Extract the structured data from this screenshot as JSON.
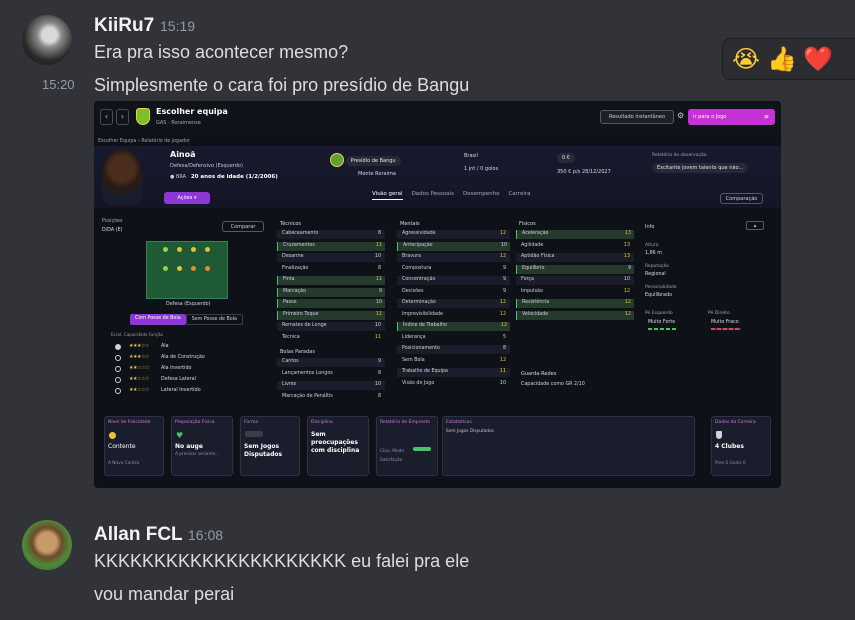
{
  "messages": [
    {
      "username": "KiiRu7",
      "time": "15:19",
      "lines": [
        "Era pra isso acontecer mesmo?",
        "Simplesmente o cara foi pro presídio de Bangu"
      ],
      "line_time": "15:20"
    },
    {
      "username": "Allan FCL",
      "time": "16:08",
      "lines": [
        "KKKKKKKKKKKKKKKKKKKKK eu falei pra ele",
        "vou mandar perai"
      ]
    }
  ],
  "reactions": [
    "😭",
    "👍",
    "❤️"
  ],
  "game": {
    "header_title": "Escolher equipa",
    "header_sub": "GAS  ·  Roraimense",
    "result_button": "Resultado instantâneo",
    "go_button": "Ir para o Jogo",
    "breadcrumb": "Escolher Equipa  ›  Relatório de jogador",
    "player_name": "Ainoã",
    "player_position": "Defesa/Defensivo (Esquerdo)",
    "player_nation": "BRA",
    "player_age": "20 anos de idade (1/2/2006)",
    "actions_button": "Ações",
    "club_name": "Presídio de Bangu",
    "club_league": "Monte Roraima",
    "country": "Brasil",
    "stats": "1 jnt / 0 golos",
    "value": "0 €",
    "wage": "350 € p/s  28/12/2027",
    "scout_label": "Relatório de observação",
    "scout_text": "Excitante jovem talento que não...",
    "tabs": [
      "Visão geral",
      "Dados Pessoais",
      "Desempenho",
      "Carreira"
    ],
    "comparison_button": "Comparação",
    "positions_label": "Posições",
    "positions_value": "D/DA (E)",
    "compare_button": "Comparar",
    "pitch_caption": "Defesa (Esquerdo)",
    "ball_tabs": [
      "Com Posse de Bola",
      "Sem Posse de Bola"
    ],
    "role_header": "Escol.    Capacidade     Função",
    "roles": [
      {
        "stars": "★★★☆☆",
        "name": "Ala"
      },
      {
        "stars": "★★★☆☆",
        "name": "Ala de Construção"
      },
      {
        "stars": "★★☆☆☆",
        "name": "Ala Invertido"
      },
      {
        "stars": "★★☆☆☆",
        "name": "Defesa Lateral"
      },
      {
        "stars": "★★☆☆☆",
        "name": "Lateral Invertido"
      }
    ],
    "attributes": {
      "tecnicos_title": "Técnicos",
      "tecnicos": [
        [
          "Cabeceamento",
          "8"
        ],
        [
          "Cruzamentos",
          "11"
        ],
        [
          "Desarme",
          "10"
        ],
        [
          "Finalização",
          "8"
        ],
        [
          "Finta",
          "11"
        ],
        [
          "Marcação",
          "9"
        ],
        [
          "Passe",
          "10"
        ],
        [
          "Primeiro Toque",
          "11"
        ],
        [
          "Remates de Longe",
          "10"
        ],
        [
          "Técnica",
          "11"
        ]
      ],
      "bolas_title": "Bolas Paradas",
      "bolas": [
        [
          "Cantos",
          "9"
        ],
        [
          "Lançamentos Longos",
          "8"
        ],
        [
          "Livres",
          "10"
        ],
        [
          "Marcação de Penáltis",
          "8"
        ]
      ],
      "mentais_title": "Mentais",
      "mentais": [
        [
          "Agressividade",
          "12"
        ],
        [
          "Antecipação",
          "10"
        ],
        [
          "Bravura",
          "12"
        ],
        [
          "Compostura",
          "9"
        ],
        [
          "Concentração",
          "9"
        ],
        [
          "Decisões",
          "9"
        ],
        [
          "Determinação",
          "12"
        ],
        [
          "Imprevisibilidade",
          "12"
        ],
        [
          "Índice de Trabalho",
          "12"
        ],
        [
          "Liderança",
          "5"
        ],
        [
          "Posicionamento",
          "8"
        ],
        [
          "Sem Bola",
          "12"
        ],
        [
          "Trabalho de Equipa",
          "11"
        ],
        [
          "Visão de Jogo",
          "10"
        ]
      ],
      "fisicos_title": "Físicos",
      "fisicos": [
        [
          "Aceleração",
          "13"
        ],
        [
          "Agilidade",
          "13"
        ],
        [
          "Aptidão Física",
          "13"
        ],
        [
          "Equilíbrio",
          "9"
        ],
        [
          "Força",
          "10"
        ],
        [
          "Impulsão",
          "12"
        ],
        [
          "Resistência",
          "12"
        ],
        [
          "Velocidade",
          "12"
        ]
      ],
      "gk_title": "Guarda-Redes",
      "gk_value": "Capacidade como GR  2/10"
    },
    "info": {
      "title": "Info",
      "height_label": "Altura",
      "height": "1,86 m",
      "reputation_label": "Reputação",
      "reputation": "Regional",
      "personality_label": "Personalidade",
      "personality": "Equilibrado",
      "left_foot_label": "Pé Esquerdo",
      "left_foot": "Muito Forte",
      "right_foot_label": "Pé Direito",
      "right_foot": "Muito Fraco"
    },
    "cards": [
      {
        "title": "Nível de Felicidade",
        "value": "Contente",
        "sub": "A Novo  Contra"
      },
      {
        "title": "Preparação Física",
        "value": "No auge",
        "sub": "A precisar seriame..."
      },
      {
        "title": "Forma",
        "value": "Sem Jogos Disputados",
        "sub": ""
      },
      {
        "title": "Disciplina",
        "value": "Sem preocupações com disciplina",
        "sub": ""
      },
      {
        "title": "Relatório de Empresto",
        "value": "",
        "sub": "Clou. Mode  Satisfação"
      },
      {
        "title": "Estatísticas",
        "value": "",
        "sub": "Sem Jogos Disputados"
      },
      {
        "title": "Dados da Carreira",
        "value": "4 Clubes",
        "sub": "Pres 0   Golos 0"
      }
    ]
  },
  "colors": {
    "background": "#313338",
    "accent": "#c532d6",
    "text": "#dbdee1"
  }
}
